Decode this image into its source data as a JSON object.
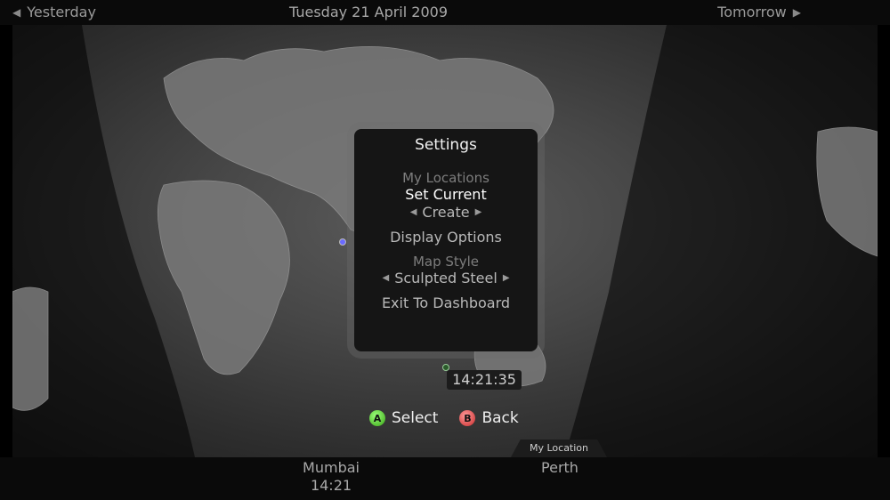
{
  "nav": {
    "prev_label": "Yesterday",
    "date": "Tuesday 21 April 2009",
    "next_label": "Tomorrow"
  },
  "settings": {
    "title": "Settings",
    "my_locations": {
      "header": "My Locations",
      "set_current": "Set Current",
      "create": "Create"
    },
    "display_options": "Display Options",
    "map_style": {
      "header": "Map Style",
      "value": "Sculpted Steel"
    },
    "exit": "Exit To Dashboard"
  },
  "clock": "14:21:35",
  "buttons": {
    "a_glyph": "A",
    "select": "Select",
    "b_glyph": "B",
    "back": "Back"
  },
  "cities": [
    {
      "name": "Mumbai",
      "time": "14:21"
    },
    {
      "name": "Perth",
      "badge": "My Location"
    }
  ],
  "colors": {
    "a_button": "#3aa516",
    "b_button": "#c92c2c"
  }
}
